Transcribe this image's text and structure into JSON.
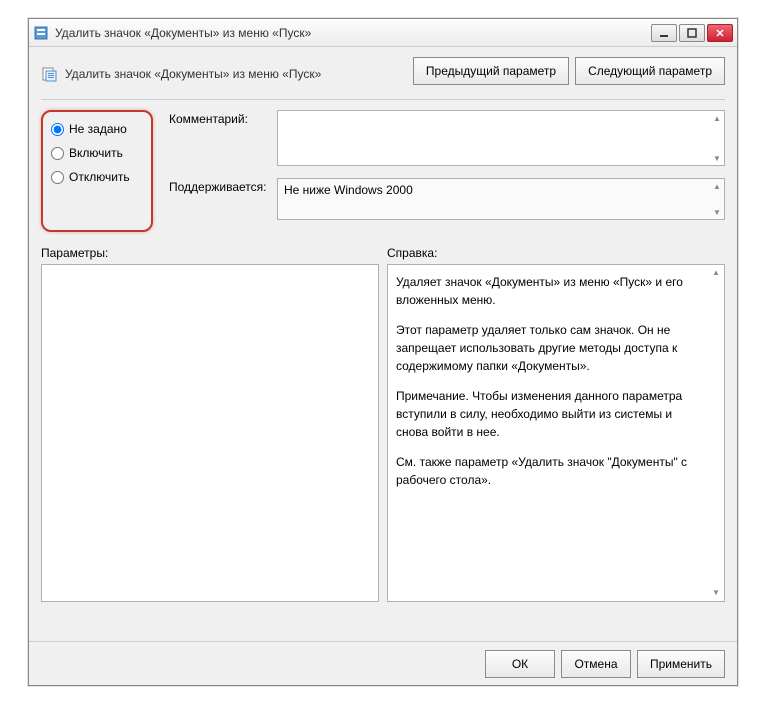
{
  "titlebar": {
    "title": "Удалить значок «Документы» из меню «Пуск»"
  },
  "header": {
    "title": "Удалить значок «Документы» из меню «Пуск»",
    "prev_btn": "Предыдущий параметр",
    "next_btn": "Следующий параметр"
  },
  "radios": {
    "not_configured": "Не задано",
    "enabled": "Включить",
    "disabled": "Отключить",
    "selected": "not_configured"
  },
  "fields": {
    "comment_label": "Комментарий:",
    "comment_value": "",
    "supported_label": "Поддерживается:",
    "supported_value": "Не ниже Windows 2000"
  },
  "lower": {
    "options_label": "Параметры:",
    "help_label": "Справка:",
    "help_text": {
      "p1": "Удаляет значок «Документы» из меню «Пуск» и его вложенных меню.",
      "p2": "Этот параметр удаляет только сам значок. Он не запрещает использовать другие методы доступа к содержимому папки «Документы».",
      "p3": "Примечание. Чтобы изменения данного параметра вступили в силу, необходимо выйти из системы и снова войти в нее.",
      "p4": "См. также параметр «Удалить значок \"Документы\" с рабочего стола»."
    }
  },
  "footer": {
    "ok": "ОК",
    "cancel": "Отмена",
    "apply": "Применить"
  }
}
